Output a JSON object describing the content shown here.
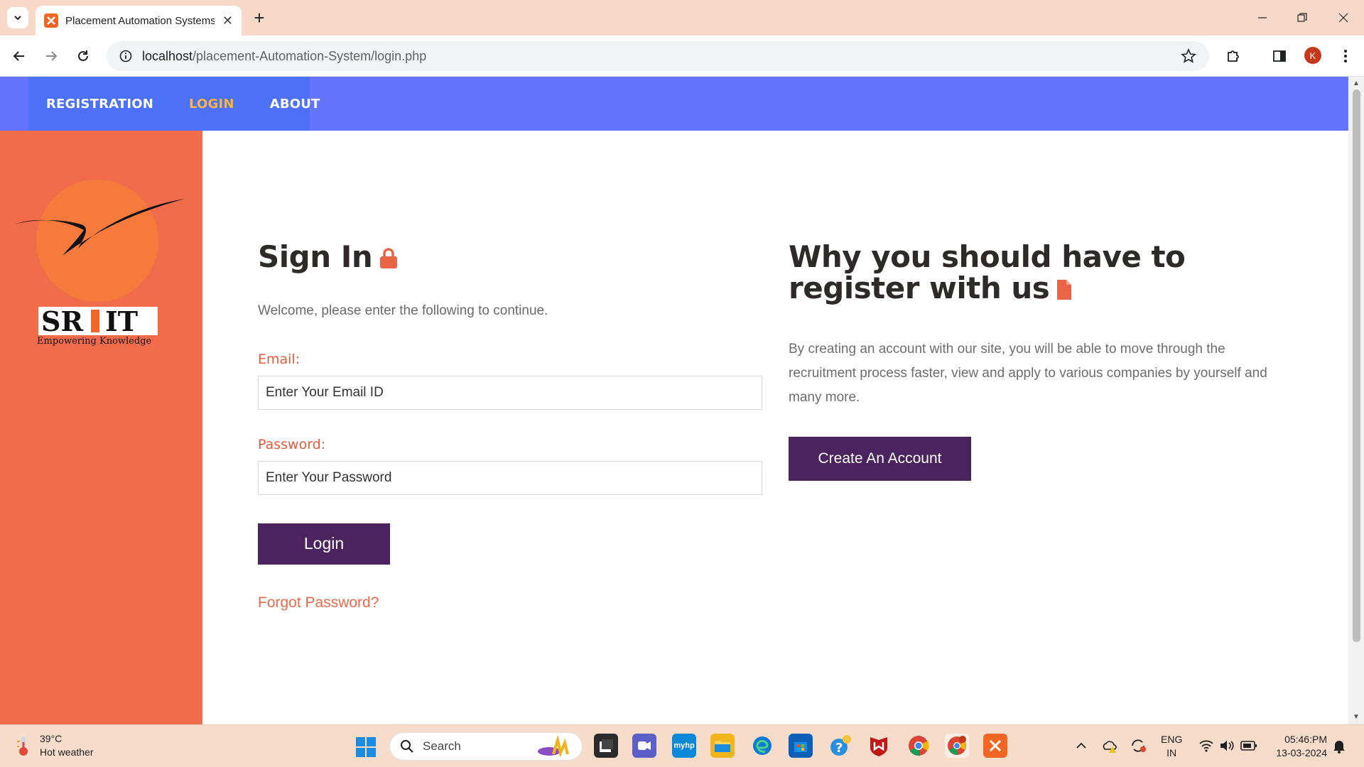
{
  "browser": {
    "tab_title": "Placement Automation Systems",
    "url_host": "localhost",
    "url_path": "/placement-Automation-System/login.php",
    "profile_initial": "K"
  },
  "nav": {
    "items": [
      {
        "label": "REGISTRATION"
      },
      {
        "label": "LOGIN"
      },
      {
        "label": "ABOUT"
      }
    ],
    "active_color": "#f7b540"
  },
  "logo": {
    "text_top": "SR IT",
    "tagline": "Empowering Knowledge"
  },
  "signin": {
    "title": "Sign In",
    "title_icon": "lock-icon",
    "welcome": "Welcome, please enter the following to continue.",
    "email_label": "Email:",
    "email_placeholder": "Enter Your Email ID",
    "password_label": "Password:",
    "password_placeholder": "Enter Your Password",
    "login_button": "Login",
    "forgot_link": "Forgot Password?"
  },
  "register": {
    "title": "Why you should have to register with us",
    "title_icon": "file-icon",
    "description": "By creating an account with our site, you will be able to move through the recruitment process faster, view and apply to various companies by yourself and many more.",
    "create_button": "Create An Account"
  },
  "colors": {
    "nav_bg": "#6474fd",
    "nav_group_bg": "#4c71f7",
    "sidebar_bg": "#f26b4a",
    "button_bg": "#4b245f",
    "label_color": "#e55b3c"
  },
  "taskbar": {
    "weather_temp": "39°C",
    "weather_desc": "Hot weather",
    "search_label": "Search",
    "lang_top": "ENG",
    "lang_bottom": "IN",
    "time": "05:46:PM",
    "date": "13-03-2024"
  }
}
